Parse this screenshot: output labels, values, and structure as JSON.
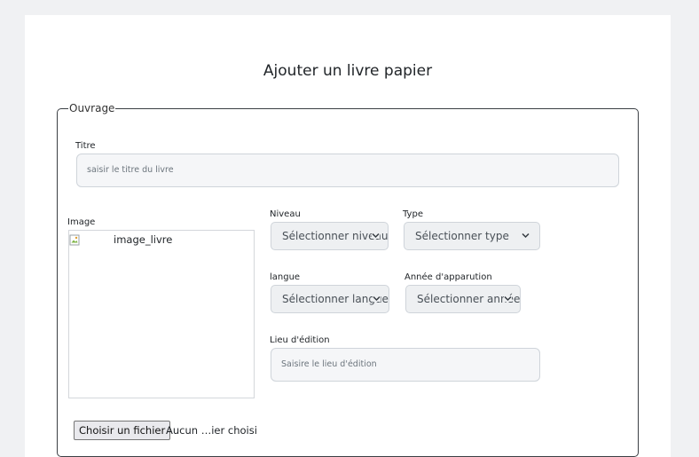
{
  "page": {
    "title": "Ajouter un livre papier"
  },
  "ouvrage": {
    "legend": "Ouvrage",
    "titre": {
      "label": "Titre",
      "placeholder": "saisir le titre du livre"
    },
    "image": {
      "label": "Image",
      "alt": "image_livre"
    },
    "niveau": {
      "label": "Niveau",
      "selected": "Sélectionner niveau"
    },
    "type": {
      "label": "Type",
      "selected": "Sélectionner type"
    },
    "langue": {
      "label": "langue",
      "selected": "Sélectionner langue"
    },
    "annee": {
      "label": "Année d'apparution",
      "selected": "Sélectionner année"
    },
    "lieu": {
      "label": "Lieu d'édition",
      "placeholder": "Saisire le lieu d'édition"
    },
    "file": {
      "button": "Choisir un fichier",
      "status": "Aucun …ier choisi"
    }
  },
  "icons": {
    "select_arrow": "chevron-down-icon",
    "broken_image": "broken-image-icon"
  }
}
